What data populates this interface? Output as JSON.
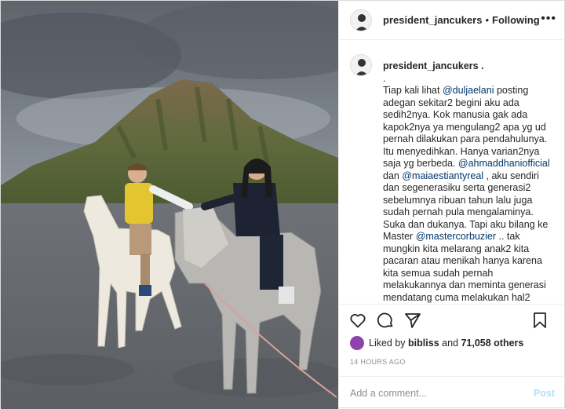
{
  "photo": {
    "description_icon": "photo-image"
  },
  "header": {
    "username": "president_jancukers",
    "separator": "•",
    "follow_status": "Following",
    "more_icon": "more-icon"
  },
  "caption": {
    "username": "president_jancukers .",
    "line2": ".",
    "seg1": "Tiap kali lihat ",
    "m1": "@duljaelani",
    "seg2": " posting adegan sekitar2 begini aku ada sedih2nya. Kok manusia gak ada kapok2nya ya mengulang2 apa yg ud pernah dilakukan para pendahulunya. Itu menyedihkan. Hanya varian2nya saja yg berbeda. ",
    "m2": "@ahmaddhaniofficial",
    "seg3": " dan ",
    "m3": "@maiaestiantyreal",
    "seg4": " , aku sendiri dan segenerasiku serta generasi2 sebelumnya ribuan tahun lalu juga sudah pernah pula mengalaminya. Suka dan dukanya. Tapi aku bilang ke Master ",
    "m4": "@mastercorbuzier",
    "seg5": " .. tak mungkin kita melarang anak2 kita pacaran atau menikah hanya karena kita semua sudah pernah melakukannya dan meminta generasi mendatang cuma melakukan hal2"
  },
  "actions": {
    "like_icon": "heart-icon",
    "comment_icon": "comment-icon",
    "share_icon": "share-icon",
    "save_icon": "bookmark-icon"
  },
  "likes": {
    "prefix": "Liked by ",
    "user": "bibliss",
    "mid": " and ",
    "count": "71,058 others"
  },
  "timestamp": "14 HOURS AGO",
  "comment": {
    "placeholder": "Add a comment...",
    "post_label": "Post"
  },
  "colors": {
    "link": "#00376b",
    "post_button": "#b2dffc",
    "muted": "#8e8e8e"
  }
}
